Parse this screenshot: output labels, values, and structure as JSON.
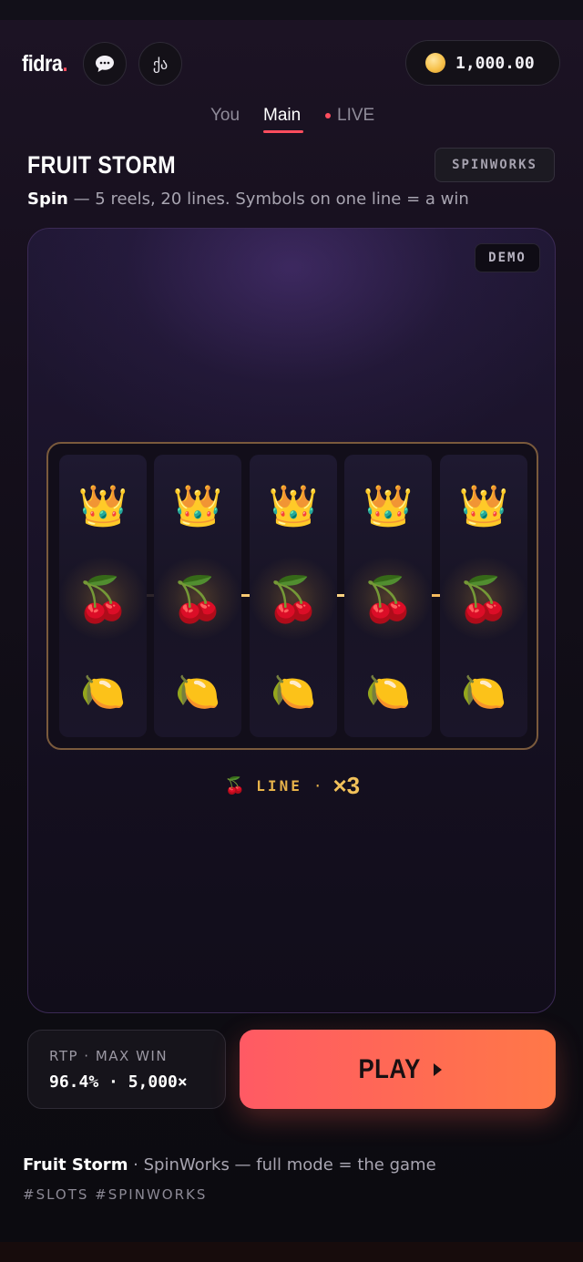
{
  "header": {
    "logo_text": "fidra",
    "logo_dot": ".",
    "chat_icon": "chat-bubble-icon",
    "language_label": "ქა",
    "balance": "1,000.00",
    "coin_icon": "coin-icon"
  },
  "tabs": [
    {
      "label": "You",
      "active": false
    },
    {
      "label": "Main",
      "active": true
    },
    {
      "label": "LIVE",
      "active": false
    }
  ],
  "game": {
    "title": "FRUIT STORM",
    "provider": "SPINWORKS",
    "subtitle_bold": "Spin",
    "subtitle_rest": " — 5 reels, 20 lines. Symbols on one line = a win",
    "mode_badge": "DEMO"
  },
  "reels": {
    "top_row": [
      "👑",
      "👑",
      "👑",
      "👑",
      "👑"
    ],
    "middle_row": [
      "🍒",
      "🍒",
      "🍒",
      "🍒",
      "🍒"
    ],
    "bottom_row": [
      "🍋",
      "🍋",
      "🍋",
      "🍋",
      "🍋"
    ]
  },
  "win": {
    "icon": "🍒",
    "label": "LINE",
    "separator": "·",
    "multiplier": "×3"
  },
  "stats": {
    "label": "RTP · MAX WIN",
    "value": "96.4% · 5,000×"
  },
  "play": {
    "label": "PLAY"
  },
  "footer": {
    "title_bold": "Fruit Storm",
    "title_rest": " · SpinWorks — full mode = the game",
    "tags": "#SLOTS #SPINWORKS"
  },
  "colors": {
    "accent": "#ff4d5e",
    "gold": "#e8b34a",
    "play_gradient_start": "#ff5a64",
    "play_gradient_end": "#ff7848"
  }
}
